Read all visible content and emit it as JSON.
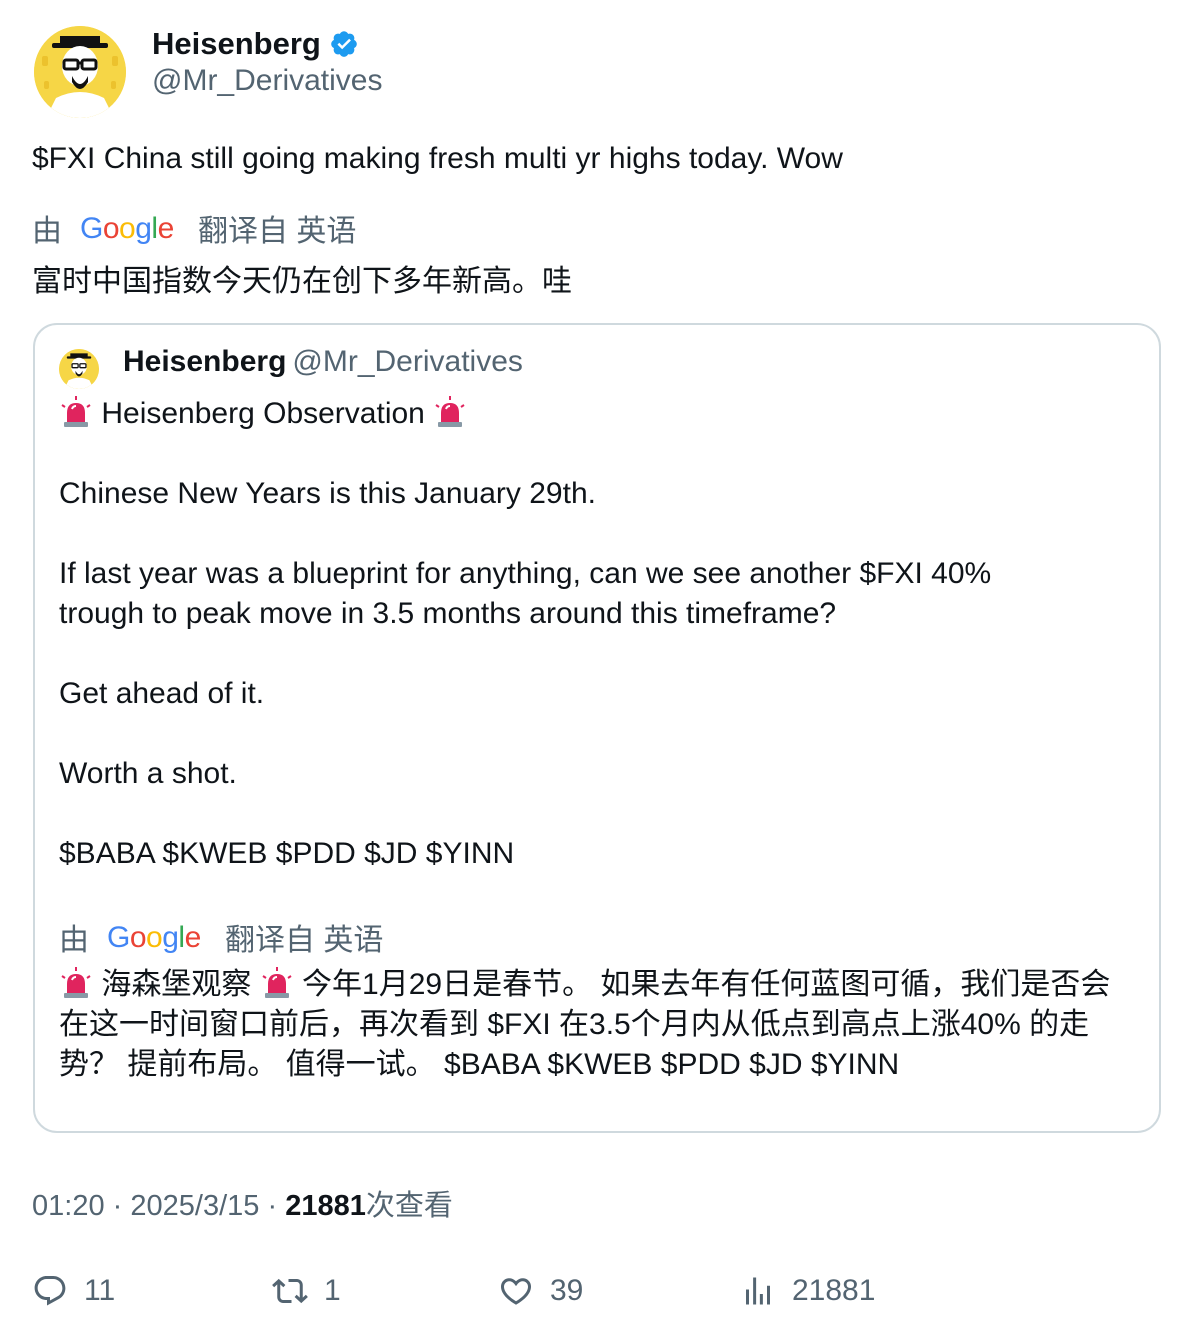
{
  "author": {
    "name": "Heisenberg",
    "handle": "@Mr_Derivatives"
  },
  "tweet": {
    "text": "$FXI China still going making fresh multi yr highs today. Wow",
    "translate_by": "由",
    "translate_brand": "Google",
    "translate_from": "翻译自 英语",
    "translated_text": "富时中国指数今天仍在创下多年新高。哇"
  },
  "quote": {
    "name": "Heisenberg",
    "handle": "@Mr_Derivatives",
    "title": "Heisenberg Observation",
    "line1": "Chinese New Years is this January 29th.",
    "line2": "If last year was a blueprint for anything, can we see another $FXI 40%",
    "line3": "trough to peak move in 3.5 months around this timeframe?",
    "line4": "Get ahead of it.",
    "line5": "Worth a shot.",
    "line6": "$BABA $KWEB $PDD $JD $YINN",
    "translate_by": "由",
    "translate_brand": "Google",
    "translate_from": "翻译自 英语",
    "translated_a": "海森堡观察",
    "translated_b": "今年1月29日是春节。 如果去年有任何蓝图可循，我们是否会在这一时间窗口前后，再次看到 $FXI 在3.5个月内从低点到高点上涨40% 的走势？ 提前布局。 值得一试。 $BABA $KWEB $PDD $JD $YINN"
  },
  "meta": {
    "time": "01:20",
    "sep1": "·",
    "date": "2025/3/15",
    "sep2": "·",
    "views": "21881",
    "views_label": "次查看"
  },
  "actions": {
    "replies": "11",
    "reposts": "1",
    "likes": "39",
    "views": "21881"
  },
  "colors": {
    "verified": "#1d9bf0",
    "muted": "#536471",
    "border": "#cfd9de",
    "alarm": "#e0245e"
  },
  "icons": [
    "verified-badge-icon",
    "alarm-icon",
    "google-logo",
    "reply-icon",
    "repost-icon",
    "like-icon",
    "views-icon"
  ]
}
